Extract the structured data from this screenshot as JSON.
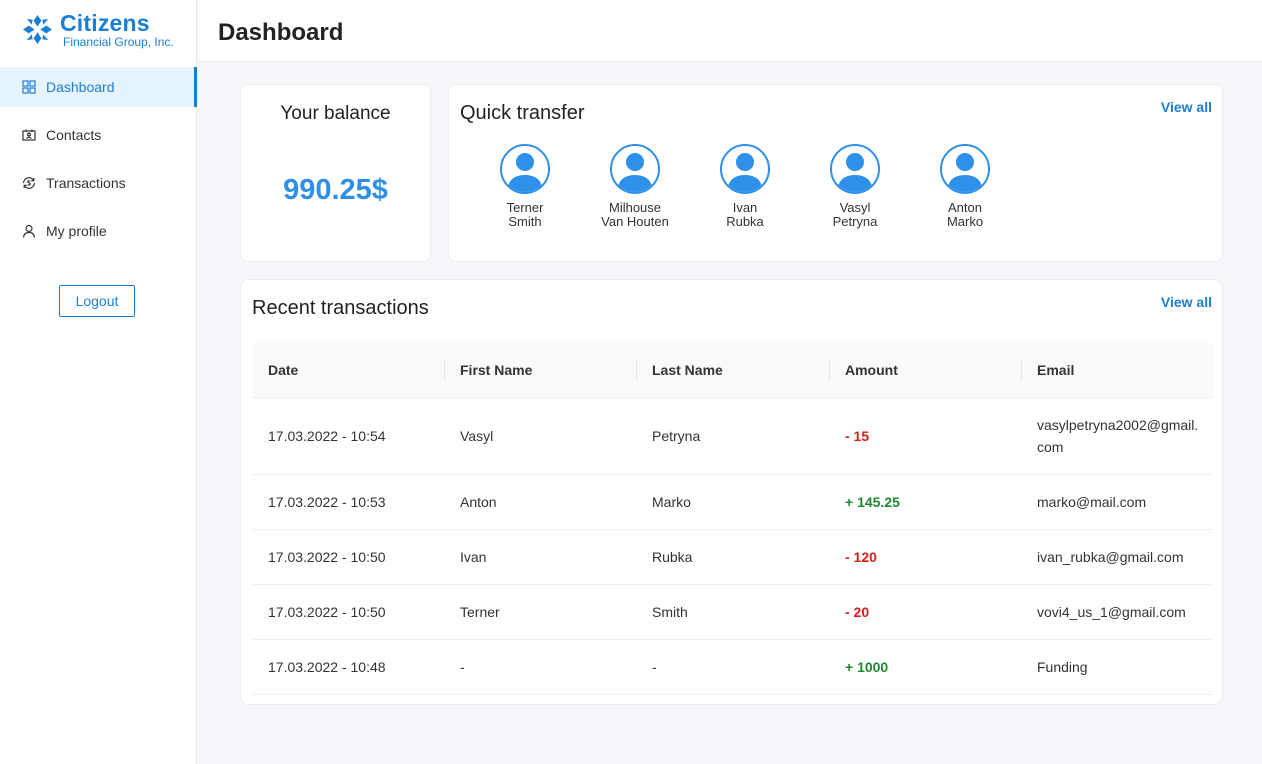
{
  "brand": {
    "name": "Citizens",
    "subtitle": "Financial Group, Inc.",
    "color": "#1a7fd4",
    "logo_icon": "citizens-logo-icon"
  },
  "sidebar": {
    "items": [
      {
        "label": "Dashboard",
        "icon": "dashboard-grid-icon",
        "active": true
      },
      {
        "label": "Contacts",
        "icon": "contacts-card-icon",
        "active": false
      },
      {
        "label": "Transactions",
        "icon": "transactions-cycle-icon",
        "active": false
      },
      {
        "label": "My profile",
        "icon": "user-icon",
        "active": false
      }
    ],
    "logout_label": "Logout"
  },
  "header": {
    "title": "Dashboard"
  },
  "balance": {
    "title": "Your balance",
    "value": "990.25$"
  },
  "quick_transfer": {
    "title": "Quick transfer",
    "view_all": "View all",
    "contacts": [
      {
        "first": "Terner",
        "last": "Smith"
      },
      {
        "first": "Milhouse",
        "last": "Van Houten"
      },
      {
        "first": "Ivan",
        "last": "Rubka"
      },
      {
        "first": "Vasyl",
        "last": "Petryna"
      },
      {
        "first": "Anton",
        "last": "Marko"
      }
    ]
  },
  "recent_transactions": {
    "title": "Recent transactions",
    "view_all": "View all",
    "columns": [
      "Date",
      "First Name",
      "Last Name",
      "Amount",
      "Email"
    ],
    "rows": [
      {
        "date": "17.03.2022 - 10:54",
        "first": "Vasyl",
        "last": "Petryna",
        "amount": "- 15",
        "type": "negative",
        "email": "vasylpetryna2002@gmail.com"
      },
      {
        "date": "17.03.2022 - 10:53",
        "first": "Anton",
        "last": "Marko",
        "amount": "+ 145.25",
        "type": "positive",
        "email": "marko@mail.com"
      },
      {
        "date": "17.03.2022 - 10:50",
        "first": "Ivan",
        "last": "Rubka",
        "amount": "- 120",
        "type": "negative",
        "email": "ivan_rubka@gmail.com"
      },
      {
        "date": "17.03.2022 - 10:50",
        "first": "Terner",
        "last": "Smith",
        "amount": "- 20",
        "type": "negative",
        "email": "vovi4_us_1@gmail.com"
      },
      {
        "date": "17.03.2022 - 10:48",
        "first": "-",
        "last": "-",
        "amount": "+ 1000",
        "type": "positive",
        "email": "Funding"
      }
    ]
  },
  "colors": {
    "accent": "#1a7fd4",
    "balance": "#2e90e8",
    "negative": "#d91e18",
    "positive": "#1e8a2e"
  }
}
